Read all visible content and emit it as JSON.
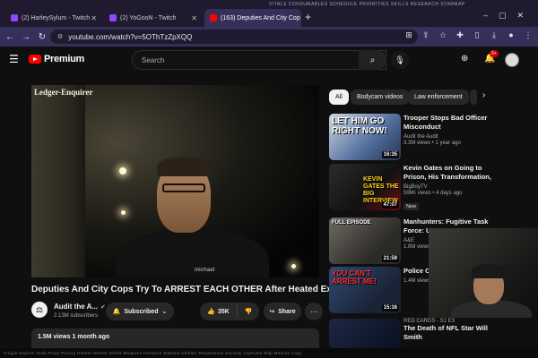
{
  "browser": {
    "tabs": [
      {
        "label": "(2) HarleySylum - Twitch"
      },
      {
        "label": "(2) YoGooN - Twitch"
      },
      {
        "label": "(163) Deputies And City Cop"
      }
    ],
    "url": "youtube.com/watch?v=5OThTzZpXQQ",
    "hud_text": "VITALS   CONSUMABLES   SCHEDULE   PRIORITIES   SKILLS   RESEARCH   STARMAP"
  },
  "youtube": {
    "logo_text": "Premium",
    "search_placeholder": "Search",
    "notification_count": "9+"
  },
  "video": {
    "watermark": "Ledger-Enquirer",
    "cam_text": "michael",
    "title": "Deputies And City Cops Try To ARREST EACH OTHER After Heated Exchange",
    "channel": "Audit the A...",
    "subscribers": "2.13M subscribers",
    "subscribed_label": "Subscribed",
    "likes": "35K",
    "share_label": "Share",
    "views_date": "1.5M views  1 month ago"
  },
  "chips": [
    "All",
    "Bodycam videos",
    "Law enforcement"
  ],
  "recommendations": [
    {
      "title": "Trooper Stops Bad Officer Misconduct",
      "channel": "Audit the Audit",
      "meta": "3.3M views • 1 year ago",
      "duration": "16:35",
      "thumb_text": "LET HIM GO RIGHT NOW!",
      "new": ""
    },
    {
      "title": "Kevin Gates on Going to Prison, His Transformation, Fasting,...",
      "channel": "BigBoyTV",
      "meta": "596K views • 4 days ago",
      "duration": "47:07",
      "thumb_text": "KEVIN GATES THE BIG INTERVIEW",
      "new": "New"
    },
    {
      "title": "Manhunters: Fugitive Task Force: US",
      "channel": "A&E",
      "meta": "1.8M views",
      "duration": "21:59",
      "thumb_text": "FULL EPISODE",
      "new": ""
    },
    {
      "title": "Police Chief ABOVE TH",
      "channel": "",
      "meta": "1.4M views",
      "duration": "15:16",
      "thumb_text": "YOU CAN'T ARREST ME!",
      "new": ""
    },
    {
      "title": "The Death of NFL Star Will Smith",
      "channel": "RED CARDS - S1 E3",
      "meta": "",
      "duration": "",
      "thumb_text": "",
      "new": ""
    }
  ],
  "taskbar_text": "Fragile   Expires   Tools   Proxy   Priority   Helmet   Helmet Shield   Weapons   Furniture   Stations   Utilities   Temperature   Security   Joylevels   Ship   Medium   Copy"
}
